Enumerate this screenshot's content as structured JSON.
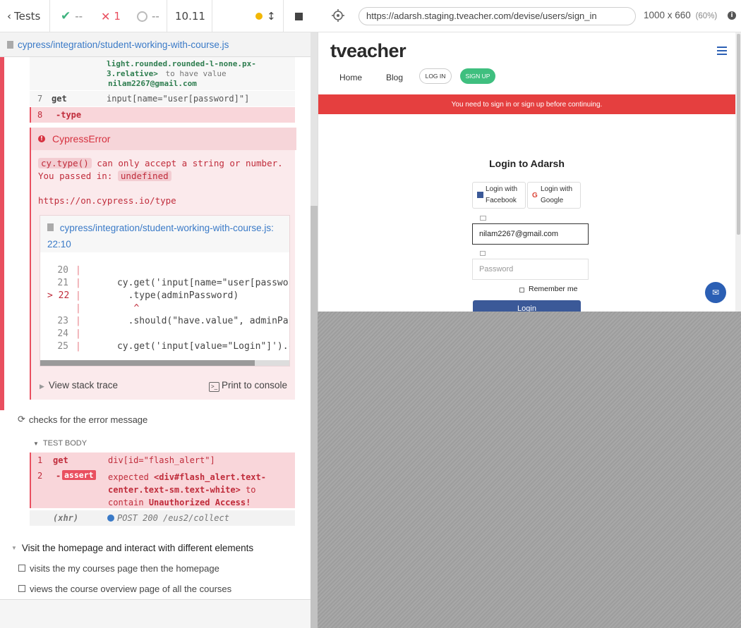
{
  "topbar": {
    "tests_label": "Tests",
    "passed": "--",
    "failed": "1",
    "pending": "--",
    "duration": "10.11"
  },
  "aut_bar": {
    "url": "https://adarsh.staging.tveacher.com/devise/users/sign_in",
    "viewport": "1000 x 660",
    "scale": "(60%)"
  },
  "spec": {
    "path": "cypress/integration/student-working-with-course.js"
  },
  "prev_cmd": {
    "line1": "light.rounded.rounded-l-none.px-",
    "line2": "3.relative>",
    "to_have_value": "to have value",
    "value": "nilam2267@gmail.com",
    "clipped_top": "                   "
  },
  "commands": [
    {
      "num": "7",
      "name": "get",
      "msg": "input[name=\"user[password]\"]"
    },
    {
      "num": "8",
      "name": "-type",
      "msg": ""
    }
  ],
  "error": {
    "title": "CypressError",
    "fn": "cy.type()",
    "text1": "can only accept a string or number.",
    "text2_prefix": "You passed in:",
    "passed_value": "undefined",
    "doc_link": "https://on.cypress.io/type",
    "code_file": "cypress/integration/student-working-with-course.js:",
    "code_loc": "22:10",
    "code_lines": [
      {
        "ln": "20",
        "src": ""
      },
      {
        "ln": "21",
        "src": "      cy.get('input[name=\"user[passwor"
      },
      {
        "ln": "> 22",
        "src": "        .type(adminPassword)"
      },
      {
        "ln": "",
        "src": "         ^"
      },
      {
        "ln": "23",
        "src": "        .should(\"have.value\", adminPas"
      },
      {
        "ln": "24",
        "src": ""
      },
      {
        "ln": "25",
        "src": "      cy.get('input[value=\"Login\"]').c"
      }
    ],
    "stack_trace": "View stack trace",
    "print_console": "Print to console"
  },
  "test2": {
    "title": "checks for the error message",
    "body_label": "TEST BODY",
    "cmds": [
      {
        "num": "1",
        "name": "get",
        "msg": "div[id=\"flash_alert\"]"
      },
      {
        "num": "2",
        "name": "assert",
        "expected": "expected",
        "el1": "<div#flash_alert.text-",
        "el2": "center.text-sm.text-white>",
        "to": "to",
        "contain": "contain",
        "val": "Unauthorized Access!"
      }
    ],
    "xhr_label": "(xhr)",
    "xhr_msg": "POST 200 /eus2/collect"
  },
  "suite": {
    "title": "Visit the homepage and interact with different elements",
    "tests": [
      "visits the my courses page then the homepage",
      "views the course overview page of all the courses"
    ]
  },
  "aut": {
    "logo": "tveacher",
    "nav": [
      "Home",
      "Blog",
      "LOG IN",
      "SIGN UP"
    ],
    "flash": "You need to sign in or sign up before continuing.",
    "login_title": "Login to Adarsh",
    "facebook": [
      "Login with",
      "Facebook"
    ],
    "google": [
      "Login with",
      "Google"
    ],
    "email_value": "nilam2267@gmail.com",
    "password_placeholder": "Password",
    "remember": "Remember me",
    "login_btn": "Login"
  },
  "colors": {
    "fail": "#e94f5f",
    "pass": "#3fb37f",
    "link": "#3a7ac7",
    "brand_green": "#3fbf7f",
    "flash_red": "#e53f3f",
    "login_blue": "#3b5998"
  }
}
